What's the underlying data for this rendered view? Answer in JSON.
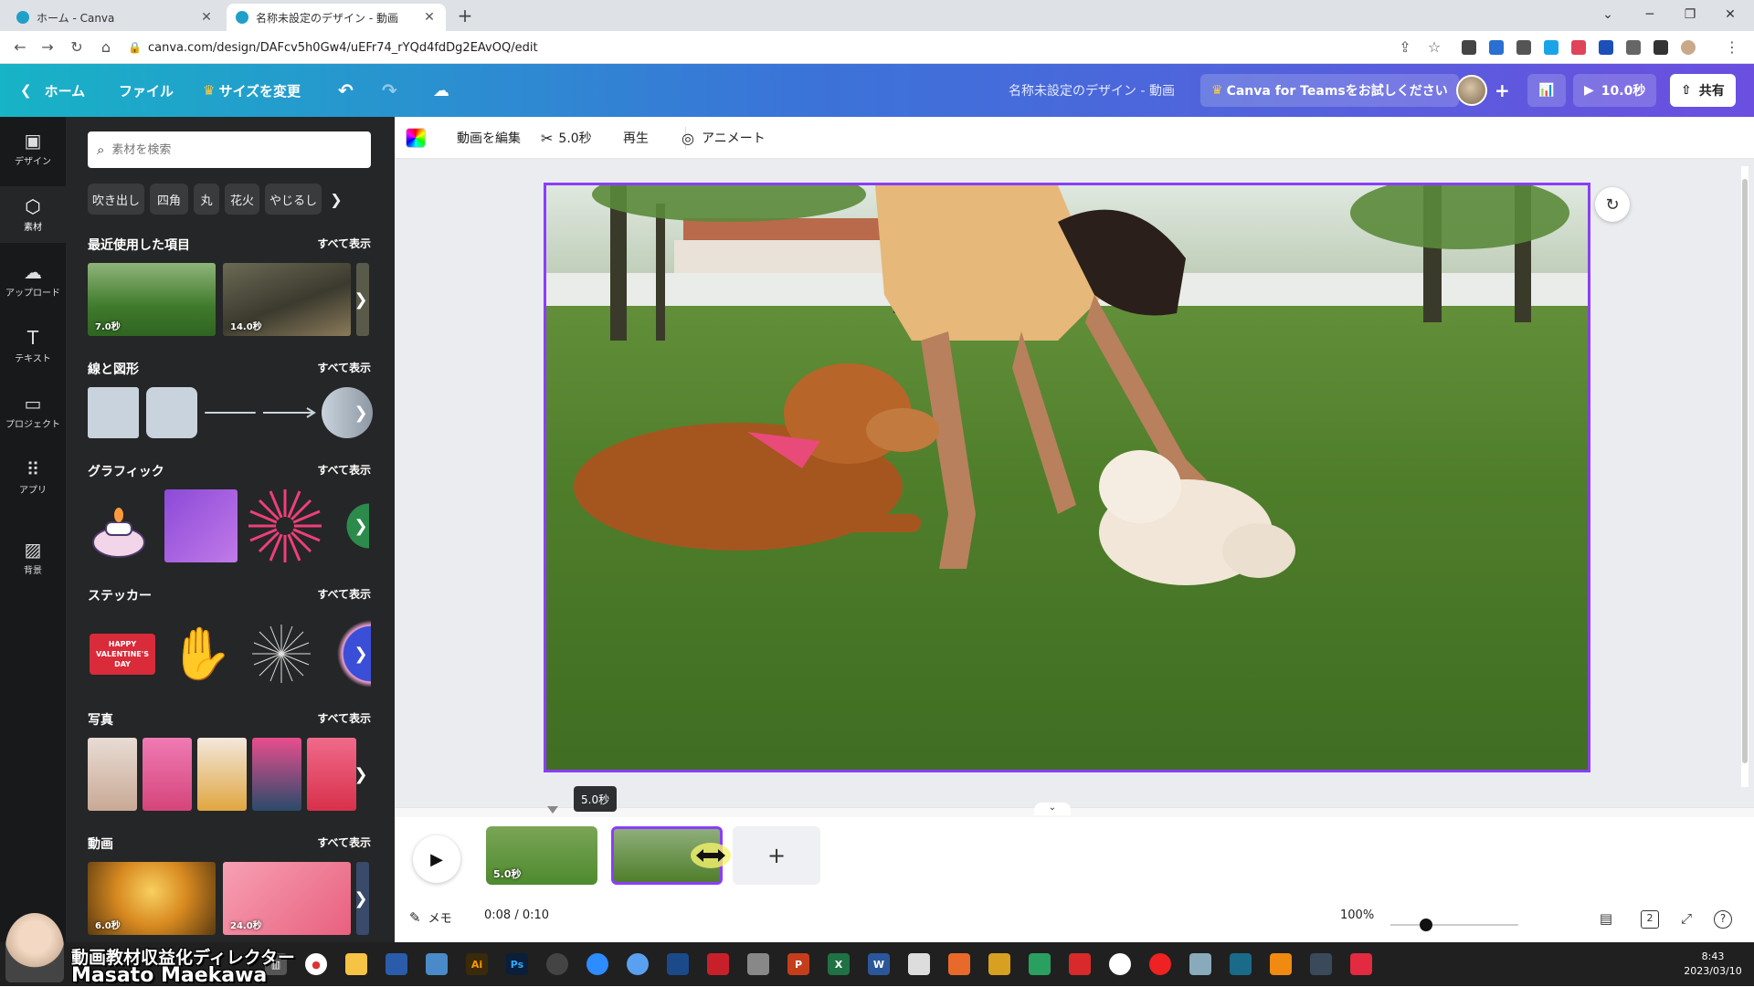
{
  "browser": {
    "tabs": [
      {
        "label": "ホーム - Canva",
        "active": false
      },
      {
        "label": "名称未設定のデザイン - 動画",
        "active": true
      }
    ],
    "new_tab": "+",
    "url": "canva.com/design/DAFcv5h0Gw4/uEFr74_rYQd4fdDg2EAvOQ/edit"
  },
  "canva_bar": {
    "home": "ホーム",
    "file": "ファイル",
    "resize": "サイズを変更",
    "design_title": "名称未設定のデザイン - 動画",
    "teams_cta": "Canva for Teamsをお試しください",
    "play_duration": "10.0秒",
    "share": "共有"
  },
  "left_rail": [
    {
      "label": "デザイン",
      "icon": "layout-icon"
    },
    {
      "label": "素材",
      "icon": "elements-icon",
      "active": true
    },
    {
      "label": "アップロード",
      "icon": "upload-icon"
    },
    {
      "label": "テキスト",
      "icon": "text-icon"
    },
    {
      "label": "プロジェクト",
      "icon": "folder-icon"
    },
    {
      "label": "アプリ",
      "icon": "apps-icon"
    },
    {
      "label": "背景",
      "icon": "background-icon"
    }
  ],
  "panel": {
    "search_placeholder": "素材を検索",
    "chips": [
      "吹き出し",
      "四角",
      "丸",
      "花火",
      "やじるし"
    ],
    "see_all": "すべて表示",
    "sections": {
      "recent": {
        "title": "最近使用した項目",
        "durations": [
          "7.0秒",
          "14.0秒"
        ]
      },
      "shapes": {
        "title": "線と図形"
      },
      "graphics": {
        "title": "グラフィック"
      },
      "stickers": {
        "title": "ステッカー",
        "sticker_text": "HAPPY VALENTINE'S DAY"
      },
      "photos": {
        "title": "写真"
      },
      "videos": {
        "title": "動画",
        "durations": [
          "6.0秒",
          "24.0秒"
        ]
      }
    }
  },
  "editor_toolbar": {
    "edit_video": "動画を編集",
    "trim_duration": "5.0秒",
    "playback": "再生",
    "animate": "アニメート"
  },
  "timeline": {
    "clips": [
      {
        "duration": "5.0秒",
        "selected": false
      },
      {
        "duration": "",
        "selected": true
      }
    ],
    "tooltip": "5.0秒",
    "add": "+",
    "memo": "メモ",
    "timecode": "0:08 / 0:10",
    "zoom": "100%",
    "zoom_level": 0.28,
    "page_count": "2"
  },
  "taskbar": {
    "time": "8:43",
    "date": "2023/03/10"
  },
  "overlay": {
    "title": "動画教材収益化ディレクター",
    "name": "Masato Maekawa"
  },
  "colors": {
    "accent": "#8b3dff",
    "panel_bg": "#252627",
    "rail_bg": "#18191b"
  }
}
